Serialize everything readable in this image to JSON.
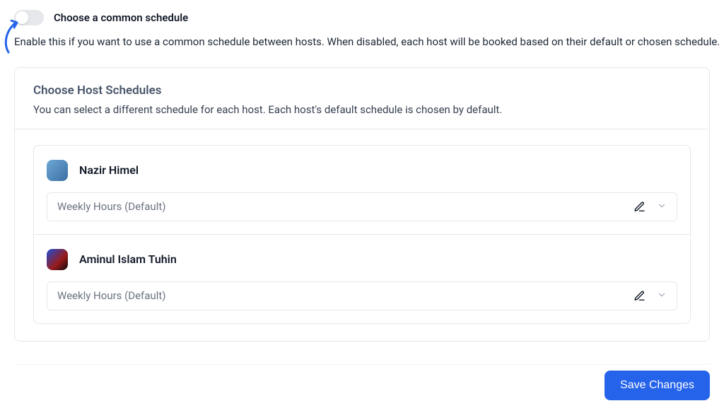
{
  "toggle": {
    "label": "Choose a common schedule",
    "state": "off"
  },
  "description": "Enable this if you want to use a common schedule between hosts. When disabled, each host will be booked based on their default or chosen schedule.",
  "card": {
    "title": "Choose Host Schedules",
    "subtitle": "You can select a different schedule for each host. Each host's default schedule is chosen by default."
  },
  "hosts": [
    {
      "name": "Nazir Himel",
      "schedule": "Weekly Hours (Default)"
    },
    {
      "name": "Aminul Islam Tuhin",
      "schedule": "Weekly Hours (Default)"
    }
  ],
  "footer": {
    "save_label": "Save Changes"
  },
  "colors": {
    "primary": "#2563eb",
    "border": "#e5e7eb",
    "text_muted": "#6b7280"
  }
}
